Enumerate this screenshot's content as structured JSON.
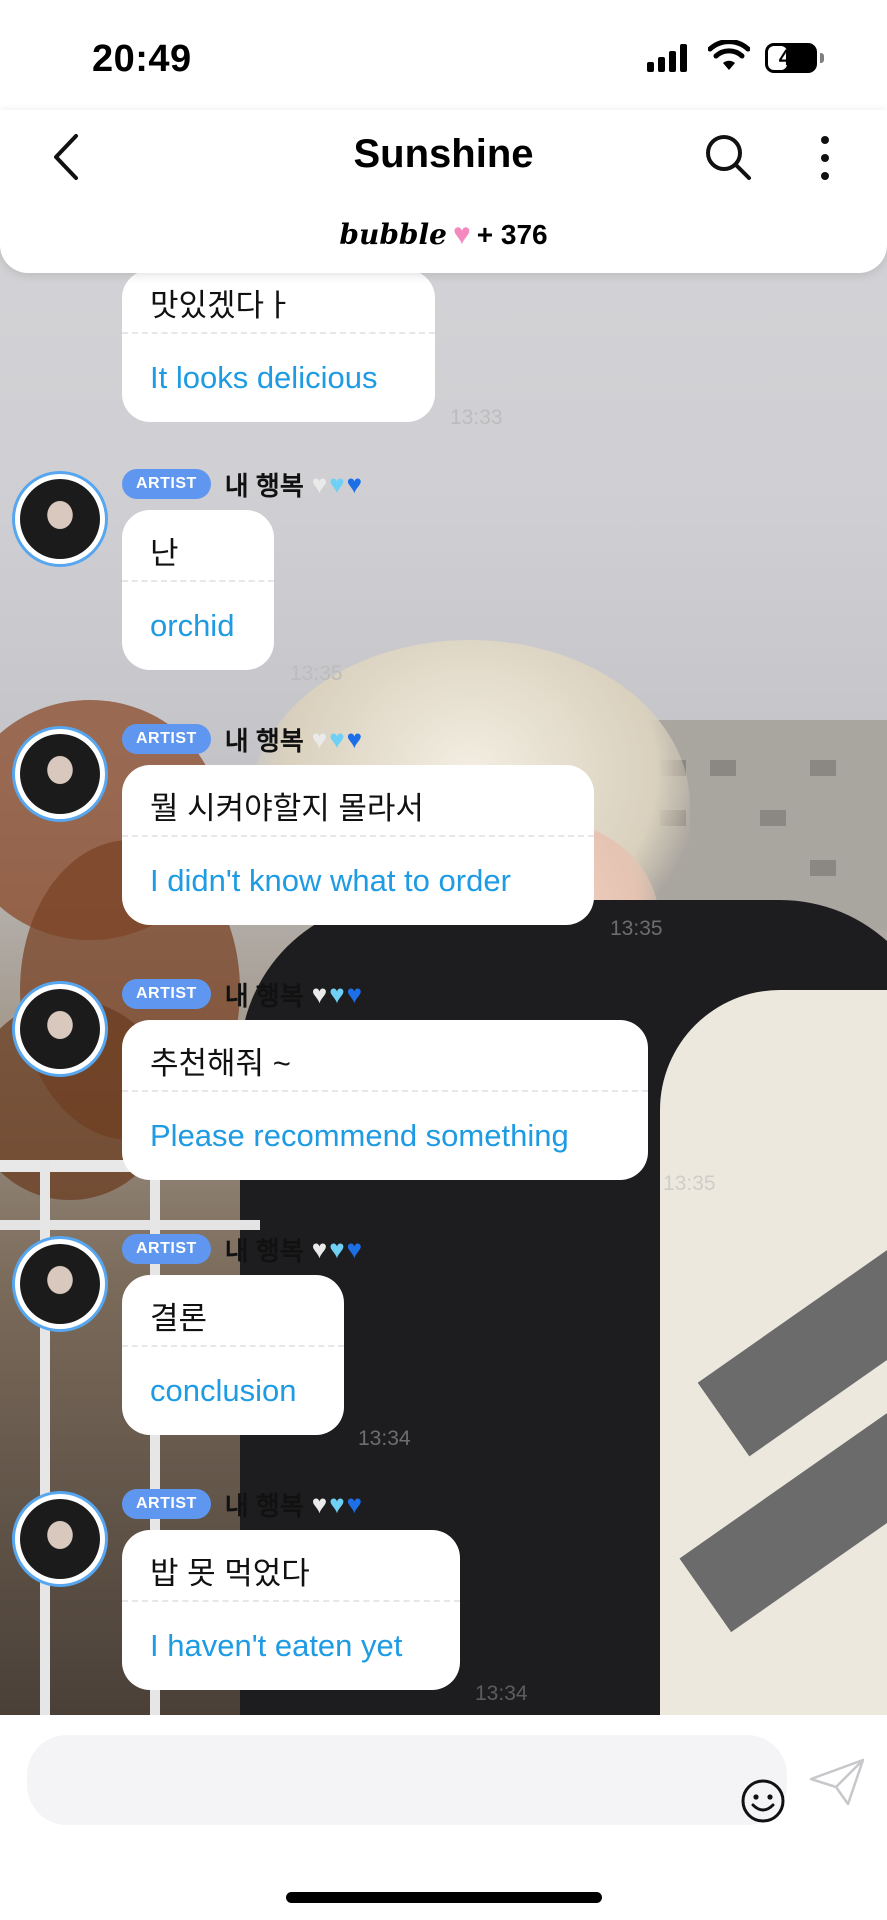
{
  "status_bar": {
    "time": "20:49",
    "battery": "41",
    "battery_level": 0.41
  },
  "header": {
    "title": "Sunshine",
    "brand": "bubble",
    "member_count": "+ 376",
    "icons": {
      "back": "chevron-left-icon",
      "search": "search-icon",
      "more": "more-vertical-icon"
    }
  },
  "artist": {
    "badge": "ARTIST",
    "name": "내 행복",
    "hearts": [
      "white-heart",
      "cyan-heart",
      "blue-heart"
    ]
  },
  "messages": [
    {
      "korean": "맛있겠다ㅏ",
      "english": "It looks delicious",
      "time": "13:33",
      "partial": true
    },
    {
      "korean": "난",
      "english": "orchid",
      "time": "13:35"
    },
    {
      "korean": "뭘 시켜야할지 몰라서",
      "english": "I didn't know what to order",
      "time": "13:35"
    },
    {
      "korean": "추천해줘 ~",
      "english": "Please recommend something",
      "time": "13:35"
    },
    {
      "korean": "결론",
      "english": "conclusion",
      "time": "13:34"
    },
    {
      "korean": "밥 못 먹었다",
      "english": "I haven't eaten yet",
      "time": "13:34"
    }
  ],
  "composer": {
    "placeholder": "",
    "icons": {
      "emoji": "emoji-icon",
      "send": "send-icon"
    }
  },
  "colors": {
    "badge": "#5f97f0",
    "translation": "#1e9be3",
    "avatar_ring": "#56a6f0"
  }
}
